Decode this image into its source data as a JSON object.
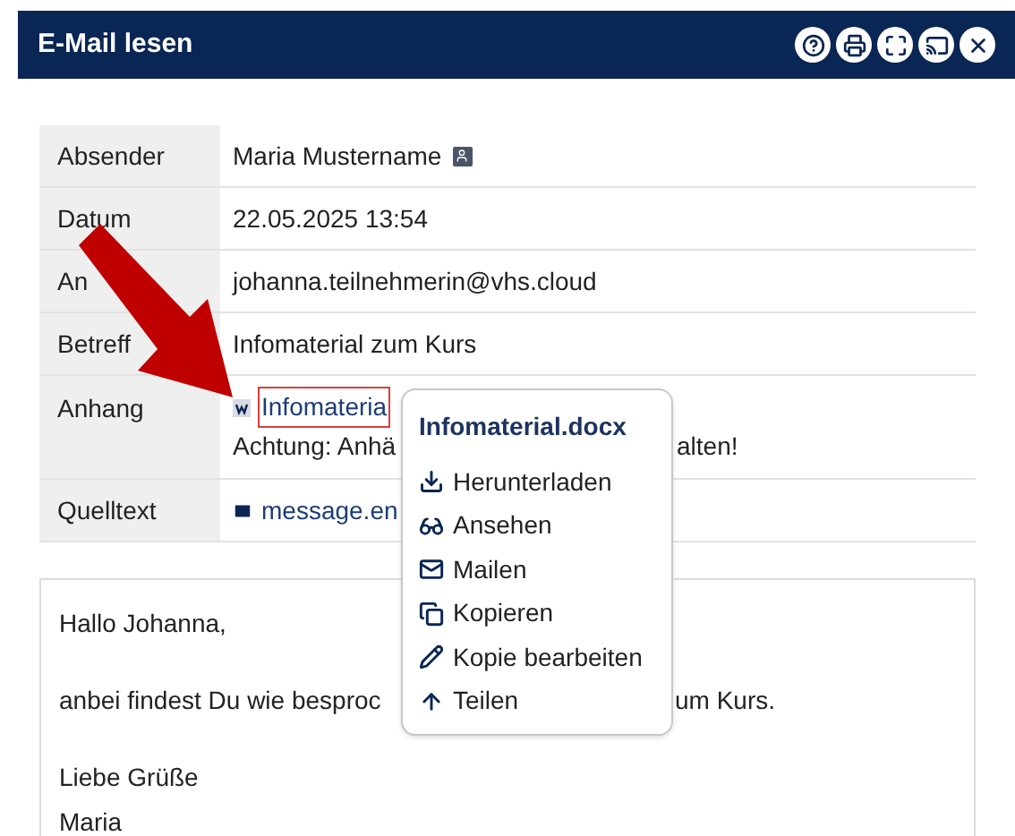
{
  "window": {
    "title": "E-Mail lesen"
  },
  "fields": [
    {
      "kind": "sender",
      "label": "Absender",
      "value": "Maria Mustername"
    },
    {
      "kind": "text",
      "label": "Datum",
      "value": "22.05.2025 13:54"
    },
    {
      "kind": "text",
      "label": "An",
      "value": "johanna.teilnehmerin@vhs.cloud"
    },
    {
      "kind": "text",
      "label": "Betreff",
      "value": "Infomaterial zum Kurs"
    },
    {
      "kind": "attachment",
      "label": "Anhang",
      "value": "Infomateria",
      "note_start": "Achtung: Anhä",
      "note_end": "alten!"
    },
    {
      "kind": "source",
      "label": "Quelltext",
      "value": "message.en"
    }
  ],
  "body": {
    "greeting": "Hallo Johanna,",
    "line_start": "anbei findest Du wie besproc",
    "line_end": "um Kurs.",
    "closing": "Liebe Grüße",
    "signature": "Maria"
  },
  "context_menu": {
    "title": "Infomaterial.docx",
    "items": [
      {
        "kind": "download",
        "label": "Herunterladen"
      },
      {
        "kind": "view",
        "label": "Ansehen"
      },
      {
        "kind": "mail",
        "label": "Mailen"
      },
      {
        "kind": "copy",
        "label": "Kopieren"
      },
      {
        "kind": "edit",
        "label": "Kopie bearbeiten"
      },
      {
        "kind": "share",
        "label": "Teilen"
      }
    ]
  }
}
